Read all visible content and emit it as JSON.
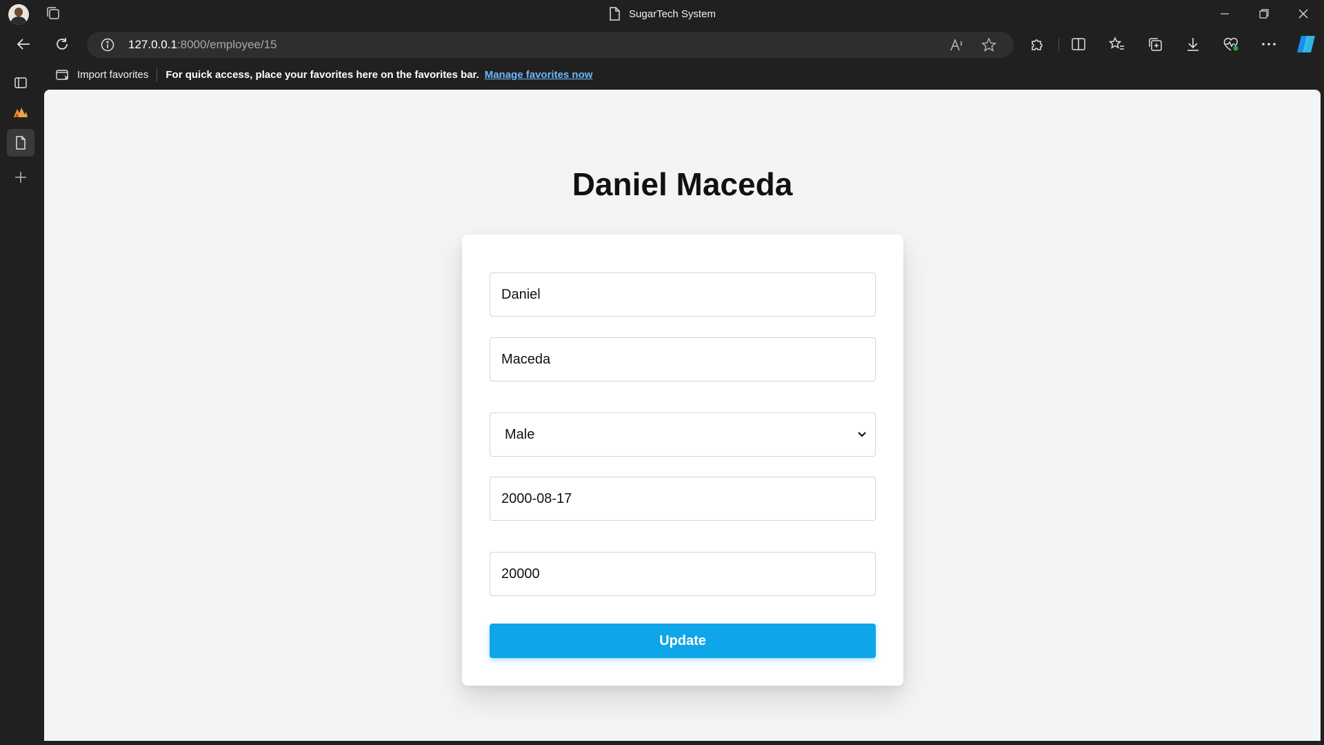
{
  "browser": {
    "window_title": "SugarTech System",
    "url_host": "127.0.0.1",
    "url_path": ":8000/employee/15"
  },
  "favorites_bar": {
    "import_label": "Import favorites",
    "message": "For quick access, place your favorites here on the favorites bar.",
    "manage_link": "Manage favorites now"
  },
  "page": {
    "title": "Daniel Maceda",
    "form": {
      "first_name": "Daniel",
      "last_name": "Maceda",
      "gender_selected": "Male",
      "birth_date": "2000-08-17",
      "salary": "20000",
      "submit_label": "Update"
    }
  },
  "colors": {
    "accent": "#0ea5e9",
    "page_background": "#f3f4f6",
    "link": "#6fb7ff"
  }
}
